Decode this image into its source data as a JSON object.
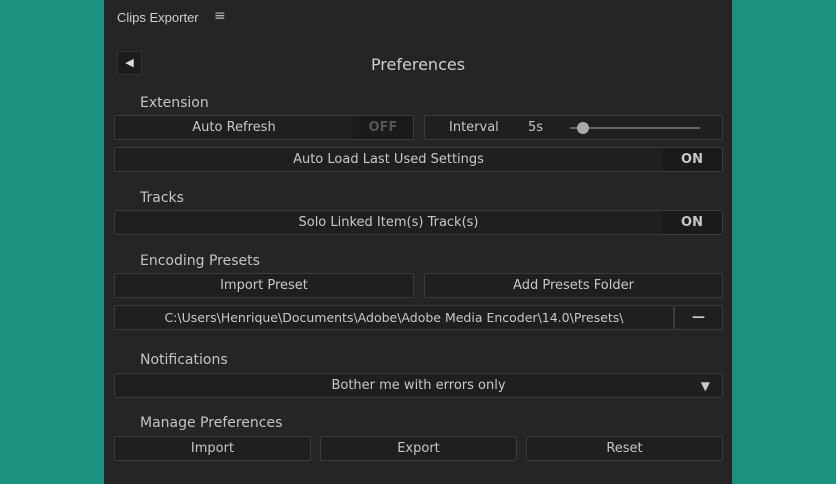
{
  "app_title": "Clips Exporter",
  "page_title": "Preferences",
  "extension": {
    "heading": "Extension",
    "auto_refresh": "Auto Refresh",
    "auto_refresh_state": "OFF",
    "interval_label": "Interval",
    "interval_value": "5s",
    "interval_fraction": 0.1,
    "auto_load": "Auto Load Last Used Settings",
    "auto_load_state": "ON"
  },
  "tracks": {
    "heading": "Tracks",
    "solo": "Solo Linked Item(s) Track(s)",
    "solo_state": "ON"
  },
  "encoding": {
    "heading": "Encoding Presets",
    "import": "Import Preset",
    "add_folder": "Add Presets Folder",
    "path": "C:\\Users\\Henrique\\Documents\\Adobe\\Adobe Media Encoder\\14.0\\Presets\\",
    "remove": "—"
  },
  "notifications": {
    "heading": "Notifications",
    "selected": "Bother me with errors only",
    "arrow": "▼"
  },
  "manage": {
    "heading": "Manage Preferences",
    "import": "Import",
    "export": "Export",
    "reset": "Reset"
  },
  "icons": {
    "menu": "≡",
    "back": "◀"
  }
}
